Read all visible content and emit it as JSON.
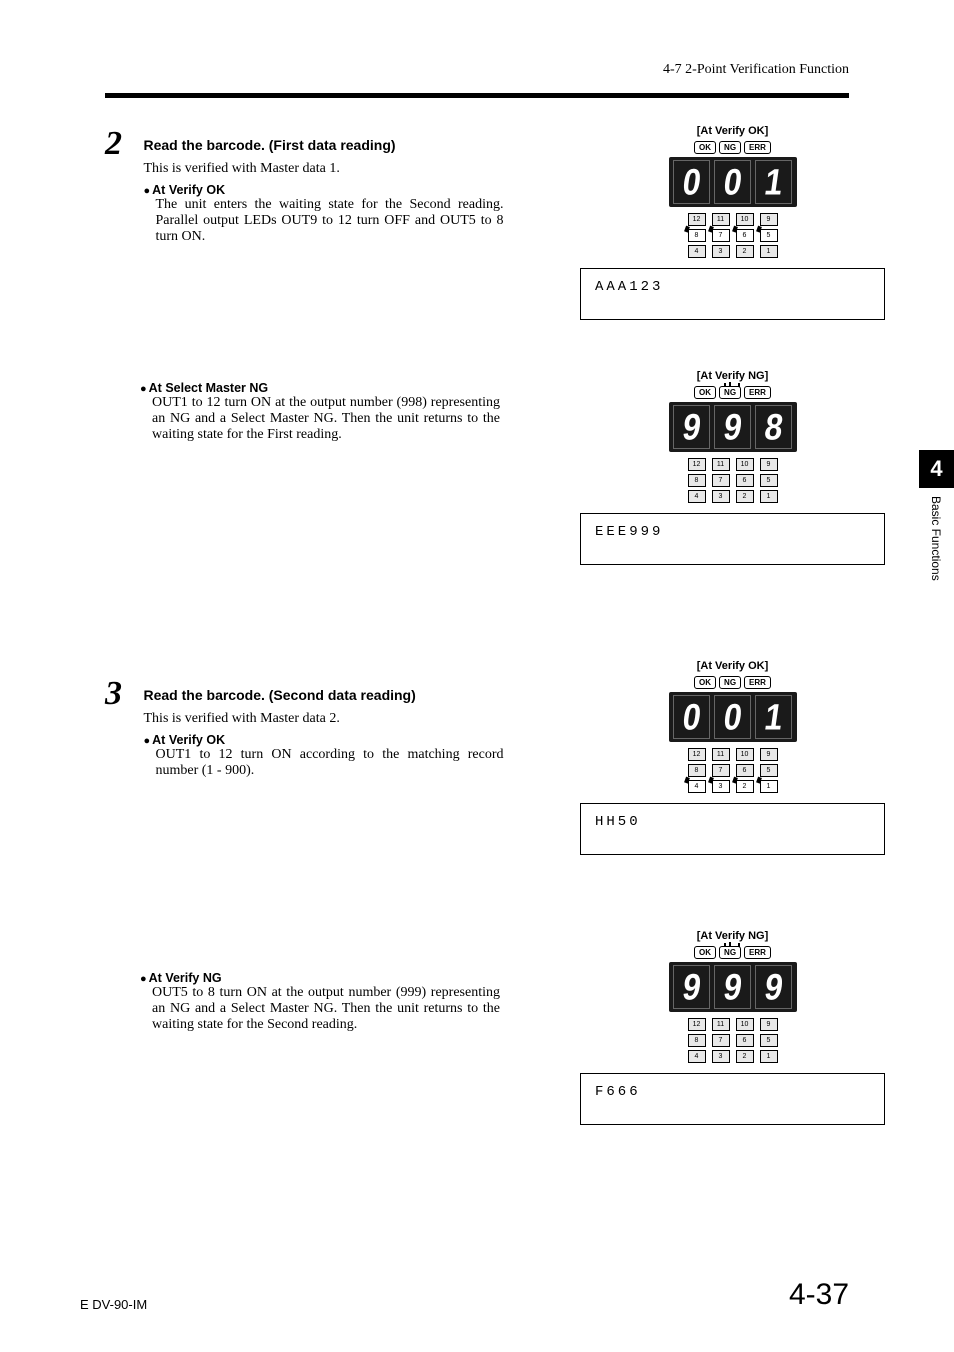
{
  "header": {
    "section": "4-7  2-Point Verification Function"
  },
  "sidetab": {
    "chapter": "4",
    "label": "Basic Functions"
  },
  "steps": [
    {
      "num": "2",
      "title": "Read the barcode. (First data reading)",
      "intro": "This is verified with Master data 1.",
      "subs": [
        {
          "head": "At Verify OK",
          "body": "The unit enters the waiting state for the Second reading. Parallel output LEDs OUT9 to 12 turn OFF and OUT5 to 8 turn ON."
        },
        {
          "head": "At Select Master NG",
          "body": "OUT1 to 12 turn ON at the output number (998) representing an NG and a Select Master NG. Then the unit returns to the waiting state for the First reading."
        }
      ]
    },
    {
      "num": "3",
      "title": "Read the barcode. (Second data reading)",
      "intro": "This is verified with Master data 2.",
      "subs": [
        {
          "head": "At Verify OK",
          "body": "OUT1 to 12 turn ON according to the matching record number (1 - 900)."
        },
        {
          "head": "At Verify NG",
          "body": "OUT5 to 8 turn ON at the output number (999) representing an NG and a Select Master NG. Then the unit returns to the waiting state for the Second reading."
        }
      ]
    }
  ],
  "displays": {
    "d1": {
      "caption": "[At Verify OK]",
      "status_active": "OK",
      "digits": "001",
      "glow_rows": [
        1
      ],
      "output": "AAA123"
    },
    "d2": {
      "caption": "[At Verify NG]",
      "status_active": "NG",
      "digits": "998",
      "glow_rows": [],
      "output": "EEE999"
    },
    "d3": {
      "caption": "[At Verify OK]",
      "status_active": "OK",
      "digits": "001",
      "glow_rows": [
        2
      ],
      "output": "HH50"
    },
    "d4": {
      "caption": "[At Verify NG]",
      "status_active": "NG",
      "digits": "999",
      "glow_rows": [],
      "output": "F666"
    }
  },
  "status_labels": [
    "OK",
    "NG",
    "ERR"
  ],
  "led_labels": [
    [
      "12",
      "11",
      "10",
      "9"
    ],
    [
      "8",
      "7",
      "6",
      "5"
    ],
    [
      "4",
      "3",
      "2",
      "1"
    ]
  ],
  "footer": {
    "docid": "E DV-90-IM",
    "page": "4-37"
  }
}
